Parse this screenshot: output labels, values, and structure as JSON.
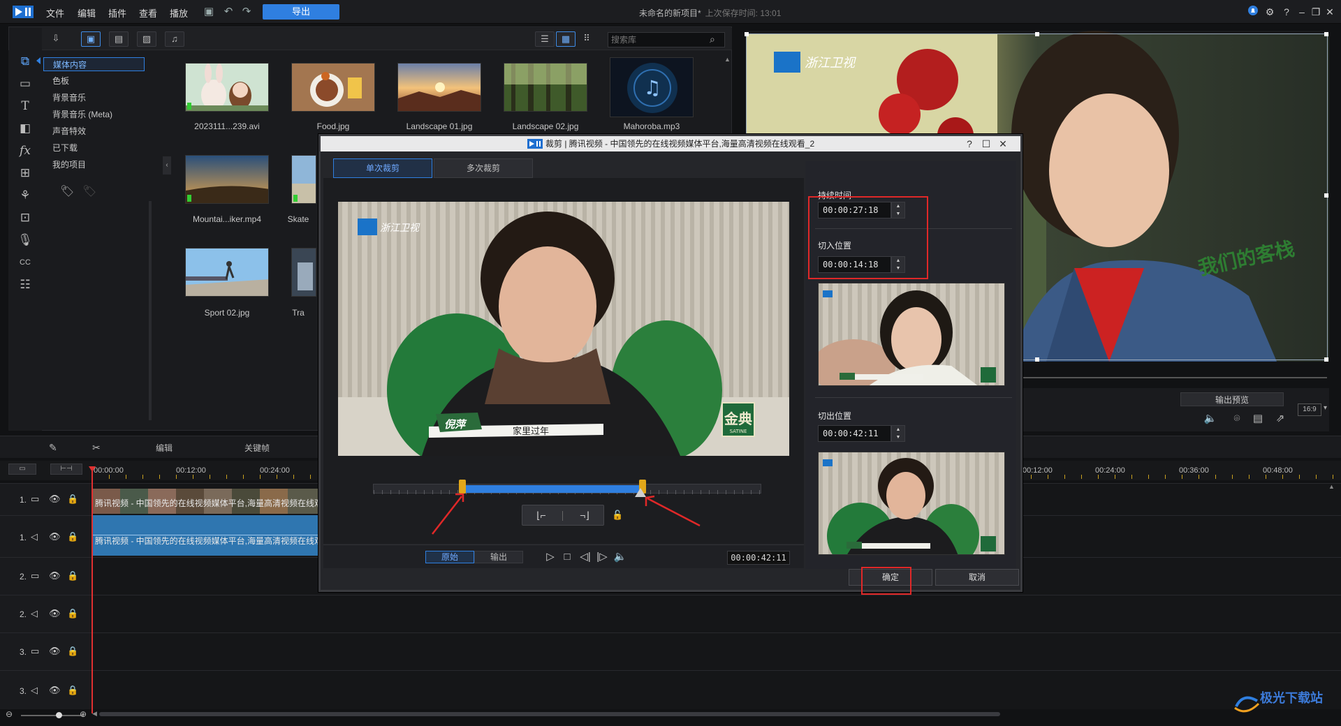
{
  "app": {
    "menus": [
      "文件",
      "编辑",
      "插件",
      "查看",
      "播放"
    ],
    "export_label": "导出",
    "project_title": "未命名的新项目*",
    "last_saved": "上次保存时间: 13:01"
  },
  "media": {
    "search_placeholder": "搜索库",
    "library_items": [
      "媒体内容",
      "色板",
      "背景音乐",
      "背景音乐 (Meta)",
      "声音特效",
      "已下载",
      "我的项目"
    ],
    "files": [
      {
        "name": "2023111...239.avi"
      },
      {
        "name": "Food.jpg"
      },
      {
        "name": "Landscape 01.jpg"
      },
      {
        "name": "Landscape 02.jpg"
      },
      {
        "name": "Mahoroba.mp3"
      },
      {
        "name": "Mountai...iker.mp4"
      },
      {
        "name": "Skate"
      },
      {
        "name": "Sport 02.jpg"
      },
      {
        "name": "Tra"
      }
    ]
  },
  "preview": {
    "output_preview_label": "输出预览",
    "ratio": "16:9",
    "logo_text": "浙江卫视"
  },
  "timeline": {
    "tools": [
      "编辑",
      "关键帧"
    ],
    "ruler_times_left": [
      "00:00:00",
      "00:12:00",
      "00:24:00"
    ],
    "ruler_times_right": [
      "00:12:00",
      "00:24:00",
      "00:36:00",
      "00:48:00"
    ],
    "tracks": [
      "1.",
      "1.",
      "2.",
      "2.",
      "3.",
      "3."
    ],
    "clip_title": "腾讯视频 - 中国领先的在线视频媒体平台,海量高清视频在线观看"
  },
  "dialog": {
    "title": "裁剪 | 腾讯视频 - 中国领先的在线视频媒体平台,海量高清视频在线观看_2",
    "tabs": [
      "单次裁剪",
      "多次裁剪"
    ],
    "duration_label": "持续时间",
    "duration_value": "00:00:27:18",
    "in_label": "切入位置",
    "in_value": "00:00:14:18",
    "out_label": "切出位置",
    "out_value": "00:00:42:11",
    "mode_original": "原始",
    "mode_output": "输出",
    "current_time": "00:00:42:11",
    "ok_label": "确定",
    "cancel_label": "取消",
    "video_logo": "浙江卫视",
    "lower_third_name": "倪萍",
    "lower_third_text": "家里过年",
    "corner_badge": "金典",
    "corner_badge_sub": "SATINE"
  },
  "watermark": {
    "text": "极光下载站"
  }
}
